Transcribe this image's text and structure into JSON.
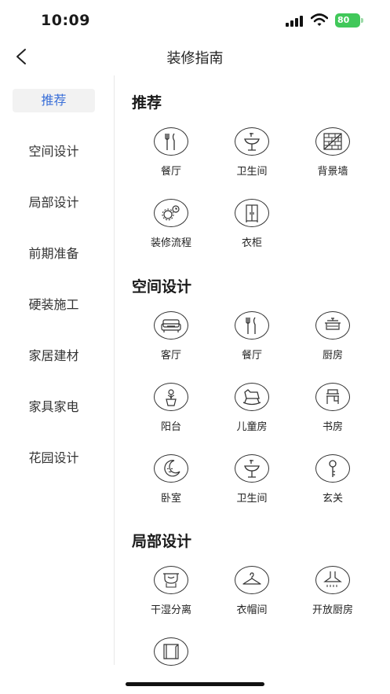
{
  "status_bar": {
    "time": "10:09",
    "battery": "80"
  },
  "nav": {
    "title": "装修指南"
  },
  "sidebar": {
    "items": [
      {
        "label": "推荐",
        "active": true
      },
      {
        "label": "空间设计",
        "active": false
      },
      {
        "label": "局部设计",
        "active": false
      },
      {
        "label": "前期准备",
        "active": false
      },
      {
        "label": "硬装施工",
        "active": false
      },
      {
        "label": "家居建材",
        "active": false
      },
      {
        "label": "家具家电",
        "active": false
      },
      {
        "label": "花园设计",
        "active": false
      }
    ]
  },
  "sections": [
    {
      "title": "推荐",
      "items": [
        {
          "label": "餐厅",
          "icon": "fork-knife-icon"
        },
        {
          "label": "卫生间",
          "icon": "washbasin-icon"
        },
        {
          "label": "背景墙",
          "icon": "brick-wall-icon"
        },
        {
          "label": "装修流程",
          "icon": "gears-clock-icon"
        },
        {
          "label": "衣柜",
          "icon": "wardrobe-icon"
        }
      ]
    },
    {
      "title": "空间设计",
      "items": [
        {
          "label": "客厅",
          "icon": "sofa-icon"
        },
        {
          "label": "餐厅",
          "icon": "fork-knife-icon"
        },
        {
          "label": "厨房",
          "icon": "cooking-pot-icon"
        },
        {
          "label": "阳台",
          "icon": "potted-plant-icon"
        },
        {
          "label": "儿童房",
          "icon": "rocking-horse-icon"
        },
        {
          "label": "书房",
          "icon": "desk-icon"
        },
        {
          "label": "卧室",
          "icon": "moon-icon"
        },
        {
          "label": "卫生间",
          "icon": "washbasin-icon"
        },
        {
          "label": "玄关",
          "icon": "key-icon"
        }
      ]
    },
    {
      "title": "局部设计",
      "items": [
        {
          "label": "干湿分离",
          "icon": "shower-screen-icon"
        },
        {
          "label": "衣帽间",
          "icon": "hanger-icon"
        },
        {
          "label": "开放厨房",
          "icon": "range-hood-icon"
        },
        {
          "label": "",
          "icon": "wall-panel-icon"
        }
      ]
    }
  ]
}
